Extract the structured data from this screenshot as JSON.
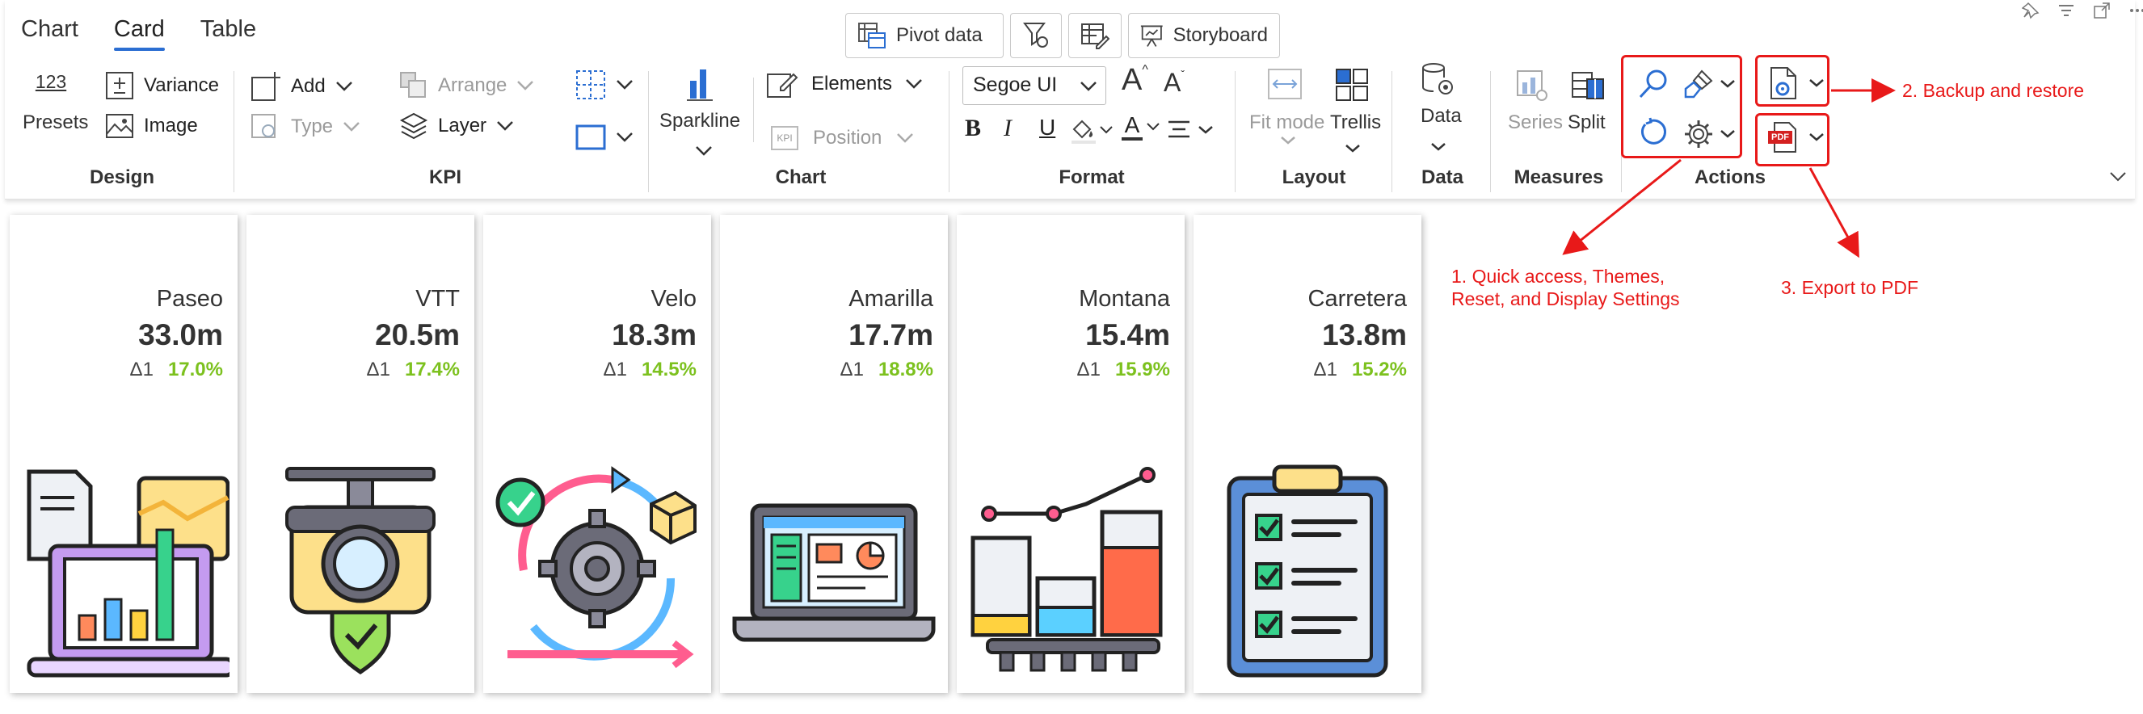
{
  "tabs": [
    "Chart",
    "Card",
    "Table"
  ],
  "active_tab": "Card",
  "toolbar": {
    "pivot_data": "Pivot data",
    "storyboard": "Storyboard"
  },
  "design": {
    "title": "Design",
    "presets_icon_text": "123",
    "presets": "Presets",
    "variance": "Variance",
    "image": "Image"
  },
  "kpi": {
    "title": "KPI",
    "add": "Add",
    "type": "Type",
    "arrange": "Arrange",
    "layer": "Layer"
  },
  "chart": {
    "title": "Chart",
    "sparkline": "Sparkline",
    "elements": "Elements",
    "position": "Position",
    "kpi_icon_text": "KPI"
  },
  "format": {
    "title": "Format",
    "font": "Segoe UI",
    "grow_glyph": "A",
    "shrink_glyph": "A",
    "bold": "B",
    "italic": "I",
    "underline": "U",
    "font_color_glyph": "A"
  },
  "layout": {
    "title": "Layout",
    "fit_mode": "Fit mode",
    "trellis": "Trellis"
  },
  "data_group": {
    "title": "Data",
    "data": "Data"
  },
  "measures": {
    "title": "Measures",
    "series": "Series",
    "split": "Split"
  },
  "actions": {
    "title": "Actions",
    "pdf_icon_text": "PDF"
  },
  "annotations": {
    "a1": "1. Quick access, Themes, Reset, and Display Settings",
    "a2": "2. Backup and restore",
    "a3": "3. Export to PDF"
  },
  "colors": {
    "accent": "#2b6ed2",
    "annotation": "#e81919",
    "positive": "#7cc11e"
  },
  "cards": [
    {
      "name": "Paseo",
      "value": "33.0m",
      "delta_label": "Δ1",
      "delta": "17.0%",
      "icon": "dashboard-report-icon"
    },
    {
      "name": "VTT",
      "value": "20.5m",
      "delta_label": "Δ1",
      "delta": "17.4%",
      "icon": "security-camera-icon"
    },
    {
      "name": "Velo",
      "value": "18.3m",
      "delta_label": "Δ1",
      "delta": "14.5%",
      "icon": "gear-cycle-icon"
    },
    {
      "name": "Amarilla",
      "value": "17.7m",
      "delta_label": "Δ1",
      "delta": "18.8%",
      "icon": "laptop-dashboard-icon"
    },
    {
      "name": "Montana",
      "value": "15.4m",
      "delta_label": "Δ1",
      "delta": "15.9%",
      "icon": "bar-chart-trend-icon"
    },
    {
      "name": "Carretera",
      "value": "13.8m",
      "delta_label": "Δ1",
      "delta": "15.2%",
      "icon": "clipboard-checklist-icon"
    }
  ]
}
